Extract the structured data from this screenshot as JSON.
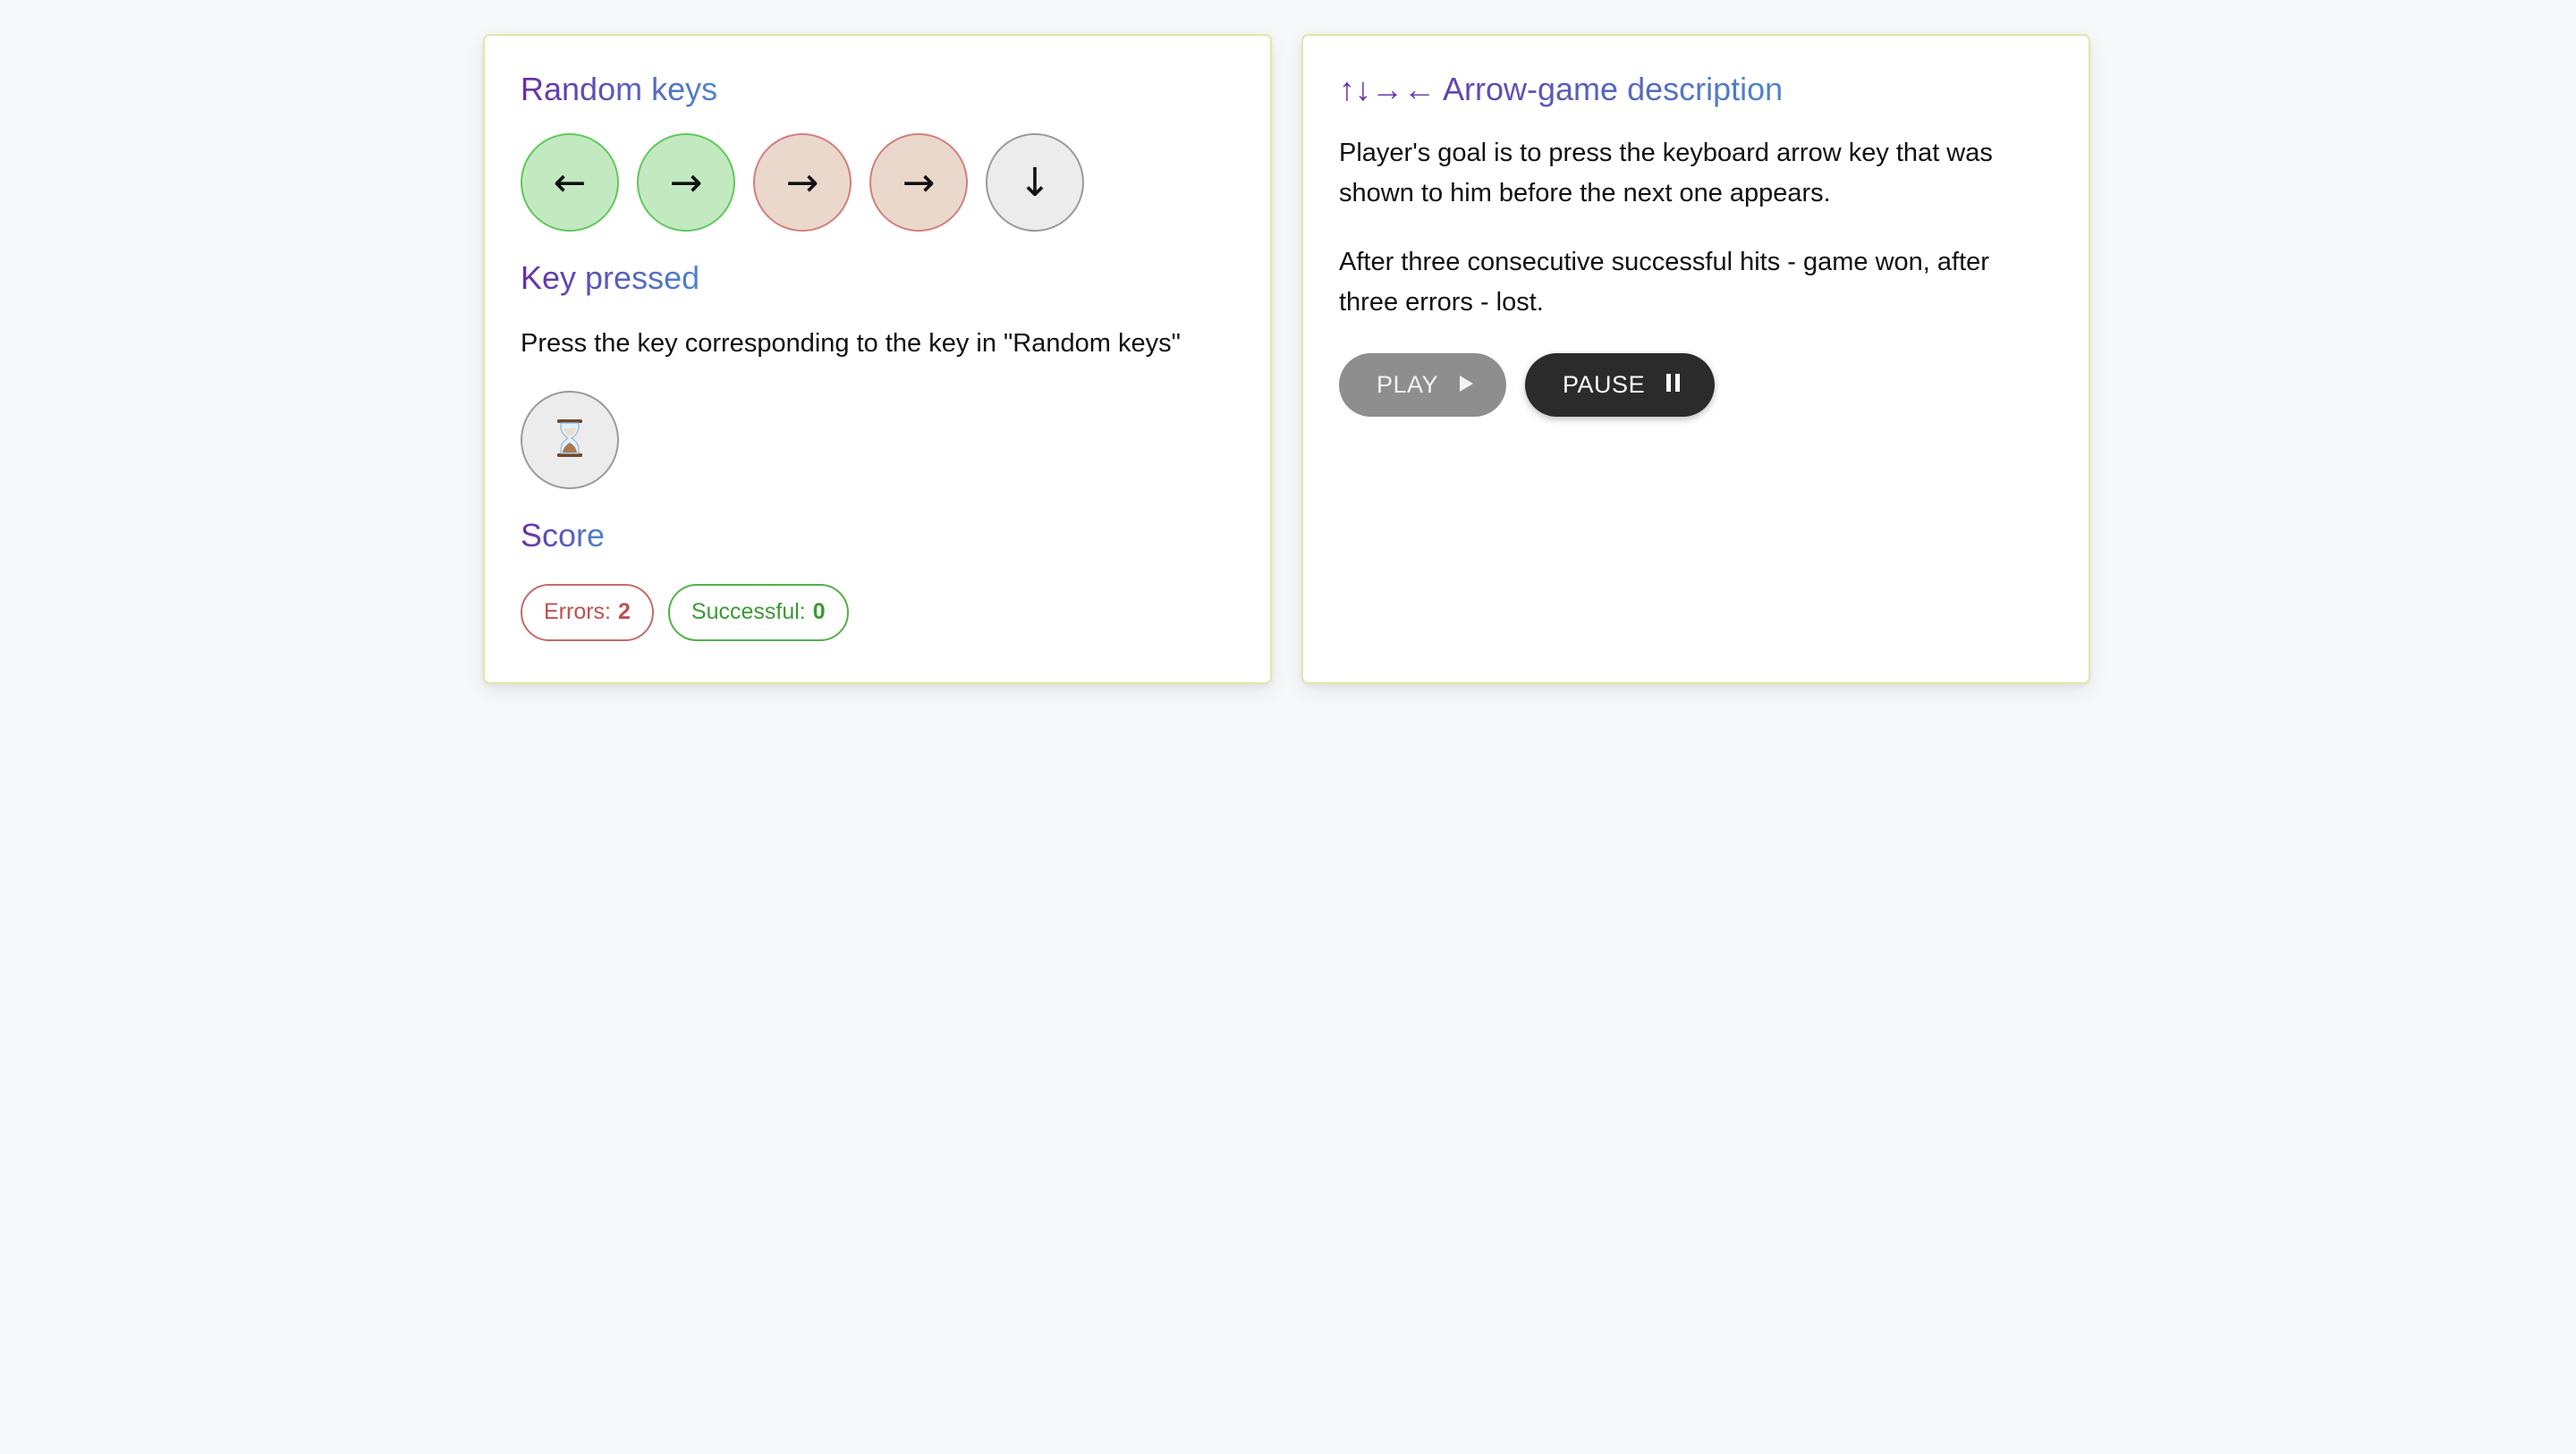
{
  "left_card": {
    "random_keys_title": "Random keys",
    "random_keys": [
      {
        "symbol": "←",
        "state": "success"
      },
      {
        "symbol": "→",
        "state": "success"
      },
      {
        "symbol": "→",
        "state": "error"
      },
      {
        "symbol": "→",
        "state": "error"
      },
      {
        "symbol": "↓",
        "state": "neutral"
      }
    ],
    "key_pressed_title": "Key pressed",
    "instruction": "Press the key corresponding to the key in \"Random keys\"",
    "pressed_key_icon": "hourglass-icon",
    "score_title": "Score",
    "errors_label": "Errors:",
    "errors_value": "2",
    "successful_label": "Successful:",
    "successful_value": "0"
  },
  "right_card": {
    "title": "↑↓→← Arrow-game description",
    "paragraph_1": "Player's goal is to press the keyboard arrow key that was shown to him before the next one appears.",
    "paragraph_2": "After three consecutive successful hits - game won, after three errors - lost.",
    "play_label": "PLAY",
    "pause_label": "PAUSE",
    "play_icon": "play-icon",
    "pause_icon": "pause-icon"
  },
  "colors": {
    "success_fill": "#c3e9c1",
    "error_fill": "#ead8cc",
    "neutral_fill": "#ececec",
    "title_gradient_start": "#6a2ea5",
    "title_gradient_end": "#4d86cf",
    "card_border": "#dfe8a6"
  }
}
